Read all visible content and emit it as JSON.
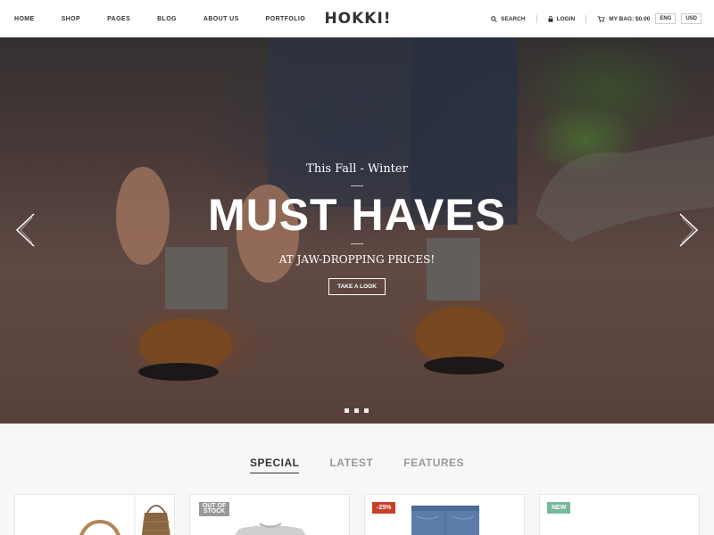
{
  "nav": {
    "items": [
      {
        "label": "HOME"
      },
      {
        "label": "SHOP"
      },
      {
        "label": "PAGES"
      },
      {
        "label": "BLOG"
      },
      {
        "label": "ABOUT US"
      },
      {
        "label": "PORTFOLIO"
      }
    ]
  },
  "logo": {
    "text": "HOKKI!"
  },
  "utilities": {
    "search_label": "SEARCH",
    "login_label": "LOGIN",
    "bag_label": "MY BAG: $0.00",
    "language": "ENG",
    "currency": "USD"
  },
  "hero": {
    "subtitle": "This Fall - Winter",
    "title": "MUST HAVES",
    "tagline": "AT JAW-DROPPING PRICES!",
    "button_label": "TAKE A LOOK",
    "slide_count": 3,
    "active_slide": 1
  },
  "tabs": [
    {
      "label": "SPECIAL",
      "active": true
    },
    {
      "label": "LATEST",
      "active": false
    },
    {
      "label": "FEATURES",
      "active": false
    }
  ],
  "products": [
    {
      "badge": ""
    },
    {
      "badge": "OUT OF STOCK"
    },
    {
      "badge": "-25%"
    },
    {
      "badge": "NEW"
    }
  ],
  "colors": {
    "accent_sale": "#c8402a",
    "badge_new": "#78b89c",
    "badge_out_of_stock": "#999999",
    "text_dark": "#333333"
  }
}
